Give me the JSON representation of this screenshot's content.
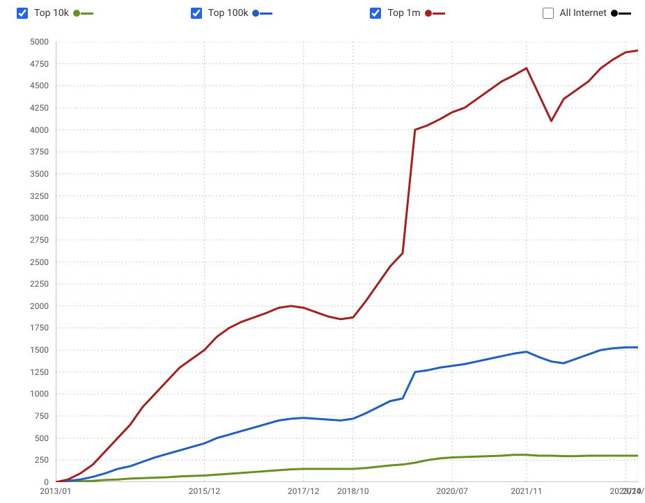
{
  "legend": {
    "items": [
      {
        "label": "Top 10k",
        "checked": true,
        "color": "#6b8e23"
      },
      {
        "label": "Top 100k",
        "checked": true,
        "color": "#1f5fbf"
      },
      {
        "label": "Top 1m",
        "checked": true,
        "color": "#a42020"
      },
      {
        "label": "All Internet",
        "checked": false,
        "color": "#000000"
      }
    ]
  },
  "chart_data": {
    "type": "line",
    "xlabel": "",
    "ylabel": "",
    "ylim": [
      0,
      5000
    ],
    "y_ticks": [
      0,
      250,
      500,
      750,
      1000,
      1250,
      1500,
      1750,
      2000,
      2250,
      2500,
      2750,
      3000,
      3250,
      3500,
      3750,
      4000,
      4250,
      4500,
      4750,
      5000
    ],
    "x_ticks": [
      "2013/01",
      "2015/12",
      "2017/12",
      "2018/10",
      "2020/07",
      "2021/11",
      "2023/10",
      "2024/01"
    ],
    "x": [
      "2013/01",
      "2013/04",
      "2013/07",
      "2013/10",
      "2014/01",
      "2014/04",
      "2014/07",
      "2014/10",
      "2015/01",
      "2015/04",
      "2015/07",
      "2015/10",
      "2015/12",
      "2016/04",
      "2016/07",
      "2016/10",
      "2017/01",
      "2017/04",
      "2017/07",
      "2017/10",
      "2017/12",
      "2018/02",
      "2018/04",
      "2018/07",
      "2018/10",
      "2019/01",
      "2019/04",
      "2019/07",
      "2019/09",
      "2019/10",
      "2020/01",
      "2020/04",
      "2020/07",
      "2020/10",
      "2021/01",
      "2021/04",
      "2021/07",
      "2021/09",
      "2021/11",
      "2022/01",
      "2022/04",
      "2022/07",
      "2022/10",
      "2023/01",
      "2023/04",
      "2023/07",
      "2023/10",
      "2024/01"
    ],
    "series": [
      {
        "name": "Top 10k",
        "color": "#6b8e23",
        "values": [
          0,
          5,
          10,
          15,
          25,
          30,
          40,
          45,
          50,
          55,
          65,
          70,
          75,
          85,
          95,
          105,
          115,
          125,
          135,
          145,
          150,
          150,
          150,
          150,
          150,
          160,
          175,
          190,
          200,
          220,
          250,
          270,
          280,
          285,
          290,
          295,
          300,
          310,
          310,
          300,
          300,
          295,
          295,
          300,
          300,
          300,
          300,
          300
        ]
      },
      {
        "name": "Top 100k",
        "color": "#1f5fbf",
        "values": [
          0,
          15,
          30,
          60,
          100,
          150,
          180,
          230,
          280,
          320,
          360,
          400,
          440,
          500,
          540,
          580,
          620,
          660,
          700,
          720,
          730,
          720,
          710,
          700,
          720,
          780,
          850,
          920,
          950,
          1250,
          1270,
          1300,
          1320,
          1340,
          1370,
          1400,
          1430,
          1460,
          1480,
          1420,
          1370,
          1350,
          1400,
          1450,
          1500,
          1520,
          1530,
          1530
        ]
      },
      {
        "name": "Top 1m",
        "color": "#a42020",
        "values": [
          0,
          30,
          100,
          200,
          350,
          500,
          650,
          850,
          1000,
          1150,
          1300,
          1400,
          1500,
          1650,
          1750,
          1820,
          1870,
          1920,
          1980,
          2000,
          1980,
          1930,
          1880,
          1850,
          1870,
          2050,
          2250,
          2450,
          2600,
          4000,
          4050,
          4120,
          4200,
          4250,
          4350,
          4450,
          4550,
          4620,
          4700,
          4400,
          4100,
          4350,
          4450,
          4550,
          4700,
          4800,
          4880,
          4900
        ]
      }
    ]
  }
}
